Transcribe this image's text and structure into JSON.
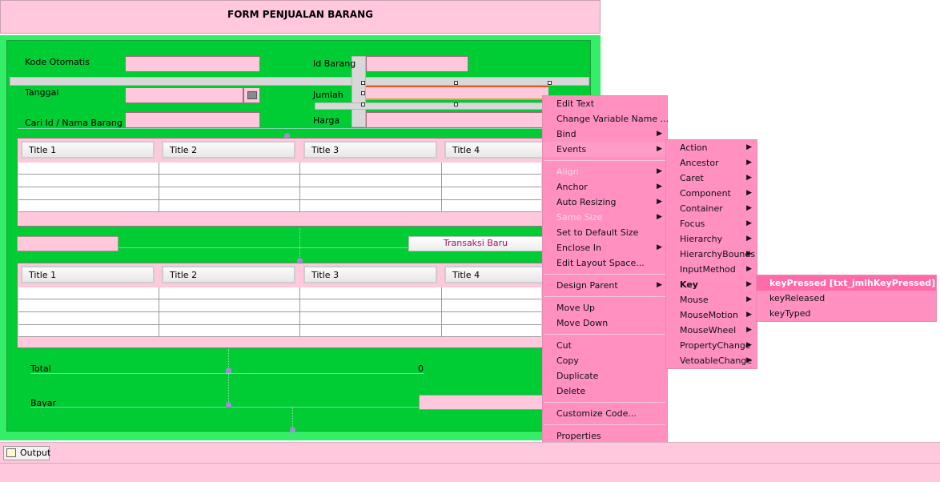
{
  "form": {
    "title": "FORM PENJUALAN BARANG",
    "labels": {
      "kode": "Kode Otomatis",
      "tanggal": "Tanggal",
      "cari": "Cari Id / Nama Barang",
      "id_barang": "Id Barang",
      "jumlah": "Jumlah",
      "harga": "Harga",
      "total": "Total",
      "bayar": "Bayar"
    },
    "total_value": "0",
    "button_transaksi": "Transaksi Baru",
    "colors": {
      "panel_pink": "#ffc8dc",
      "form_green": "#00cc33",
      "menu_pink": "#ff90c0"
    }
  },
  "table1": {
    "columns": [
      "Title 1",
      "Title 2",
      "Title 3",
      "Title 4"
    ]
  },
  "table2": {
    "columns": [
      "Title 1",
      "Title 2",
      "Title 3",
      "Title 4"
    ]
  },
  "context_menu": {
    "items": [
      "Edit Text",
      "Change Variable Name ...",
      "Bind",
      "Events",
      "Align",
      "Anchor",
      "Auto Resizing",
      "Same Size",
      "Set to Default Size",
      "Enclose In",
      "Edit Layout Space...",
      "Design Parent",
      "Move Up",
      "Move Down",
      "Cut",
      "Copy",
      "Duplicate",
      "Delete",
      "Customize Code...",
      "Properties"
    ]
  },
  "events_menu": {
    "items": [
      "Action",
      "Ancestor",
      "Caret",
      "Component",
      "Container",
      "Focus",
      "Hierarchy",
      "HierarchyBounds",
      "InputMethod",
      "Key",
      "Mouse",
      "MouseMotion",
      "MouseWheel",
      "PropertyChange",
      "VetoableChange"
    ]
  },
  "key_menu": {
    "items": [
      "keyPressed [txt_jmlhKeyPressed]",
      "keyReleased",
      "keyTyped"
    ]
  },
  "output": {
    "tab_label": "Output"
  }
}
